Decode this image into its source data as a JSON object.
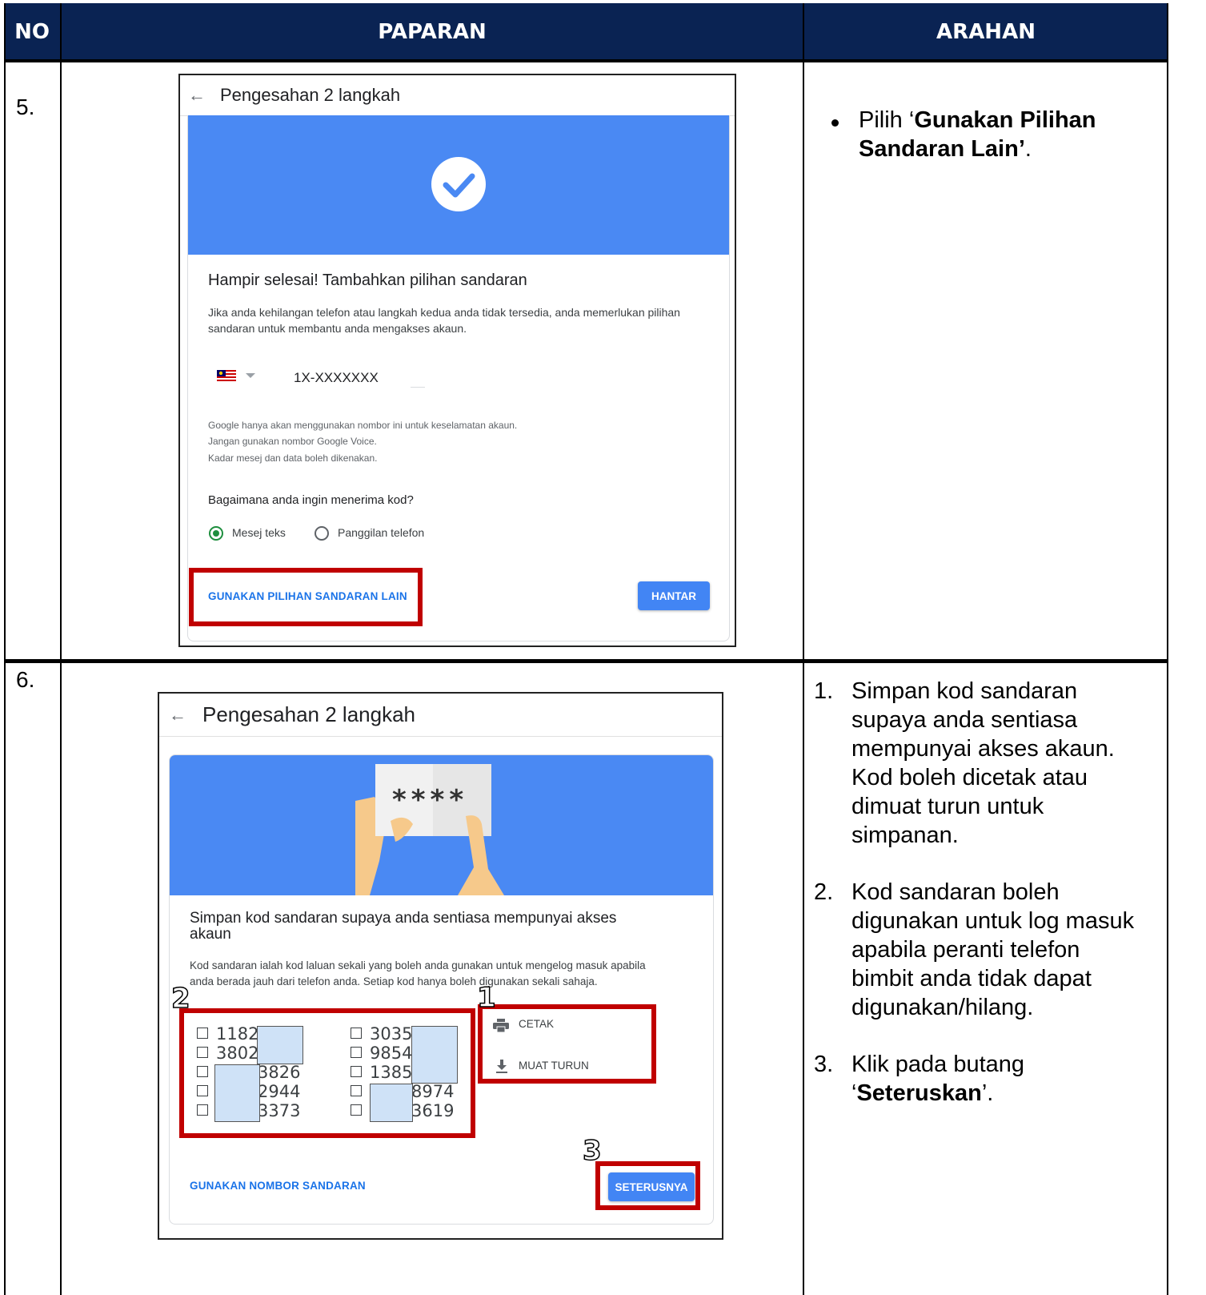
{
  "table": {
    "headers": {
      "no": "NO",
      "paparan": "PAPARAN",
      "arahan": "ARAHAN"
    }
  },
  "row5": {
    "no": "5.",
    "screen": {
      "title": "Pengesahan 2 langkah",
      "heading": "Hampir selesai! Tambahkan pilihan sandaran",
      "desc_line1": "Jika anda kehilangan telefon atau langkah kedua anda tidak tersedia, anda memerlukan pilihan",
      "desc_line2": "sandaran untuk membantu anda mengakses akaun.",
      "phone_value": "1X-XXXXXXX",
      "note1": "Google hanya akan menggunakan nombor ini untuk keselamatan akaun.",
      "note2": "Jangan gunakan nombor Google Voice.",
      "note3": "Kadar mesej dan data boleh dikenakan.",
      "question": "Bagaimana anda ingin menerima kod?",
      "option_text": "Mesej teks",
      "option_call": "Panggilan telefon",
      "selected_option": "Mesej teks",
      "link_other": "GUNAKAN PILIHAN SANDARAN LAIN",
      "btn_send": "HANTAR"
    },
    "instruction": {
      "prefix": "Pilih ‘",
      "bold_line1": "Gunakan Pilihan",
      "bold_line2": "Sandaran Lain’",
      "suffix": "."
    }
  },
  "row6": {
    "no": "6.",
    "screen": {
      "title": "Pengesahan 2 langkah",
      "banner_text": "****",
      "heading_line1": "Simpan kod sandaran supaya anda sentiasa mempunyai akses",
      "heading_line2": "akaun",
      "desc_line1": "Kod sandaran ialah kod laluan sekali yang boleh anda gunakan untuk mengelog masuk apabila",
      "desc_line2": "anda berada jauh dari telefon anda. Setiap kod hanya boleh digunakan sekali sahaja.",
      "codes_left": [
        "1182",
        "3802",
        "3826",
        "2944",
        "3373"
      ],
      "codes_right": [
        "3035",
        "9854",
        "1385",
        "8974",
        "3619"
      ],
      "action_print": "CETAK",
      "action_download": "MUAT TURUN",
      "link_backup_number": "GUNAKAN NOMBOR SANDARAN",
      "btn_next": "SETERUSNYA",
      "callout_1": "1",
      "callout_2": "2",
      "callout_3": "3"
    },
    "instructions": [
      {
        "num": "1.",
        "lines": [
          "Simpan kod sandaran",
          "supaya anda sentiasa",
          "mempunyai akses akaun.",
          "Kod boleh dicetak atau",
          "dimuat turun untuk",
          "simpanan."
        ]
      },
      {
        "num": "2.",
        "lines": [
          "Kod sandaran boleh",
          "digunakan untuk log masuk",
          "apabila peranti telefon",
          "bimbit anda tidak dapat",
          "digunakan/hilang."
        ]
      },
      {
        "num": "3.",
        "lines": [
          "Klik pada butang"
        ],
        "last_prefix": "‘",
        "last_bold": "Seteruskan",
        "last_suffix": "’."
      }
    ]
  },
  "colors": {
    "header_bg": "#0a2353",
    "banner_blue": "#4a89f3",
    "link_blue": "#1a73e8",
    "button_blue": "#4285f4",
    "highlight_red": "#c00000",
    "mask_blue": "#cfe2f7"
  }
}
